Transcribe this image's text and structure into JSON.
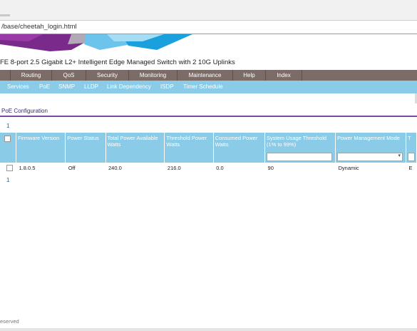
{
  "browser": {
    "address": "/base/cheetah_login.html"
  },
  "header": {
    "title": "FE 8-port 2.5 Gigabit L2+ Intelligent Edge Managed Switch with 2 10G Uplinks"
  },
  "main_menu": {
    "items": [
      {
        "label": "Routing"
      },
      {
        "label": "QoS"
      },
      {
        "label": "Security"
      },
      {
        "label": "Monitoring"
      },
      {
        "label": "Maintenance"
      },
      {
        "label": "Help"
      },
      {
        "label": "Index"
      }
    ]
  },
  "sub_menu": {
    "items": [
      {
        "label": "Services"
      },
      {
        "label": "PoE"
      },
      {
        "label": "SNMP"
      },
      {
        "label": "LLDP"
      },
      {
        "label": "Link Dependency"
      },
      {
        "label": "ISDP"
      },
      {
        "label": "Timer Schedule"
      }
    ],
    "active": "PoE"
  },
  "section": {
    "tab_label": "PoE Configuration"
  },
  "pagination": {
    "top": "1",
    "bottom": "1"
  },
  "table": {
    "headers": [
      "Firmware Version",
      "Power Status",
      "Total Power Available Watts",
      "Threshold Power Watts",
      "Consumed Power Watts",
      "System Usage Threshold (1% to 99%)",
      "Power Management Mode",
      "T"
    ],
    "rows": [
      {
        "firmware": "1.8.0.5",
        "power_status": "Off",
        "total_power": "240.0",
        "threshold_power": "216.0",
        "consumed_power": "0.0",
        "usage_threshold": "90",
        "management_mode": "Dynamic",
        "extra": "E"
      }
    ]
  },
  "footer": {
    "text": "eserved"
  },
  "colors": {
    "menu_bg": "#7c6c68",
    "submenu_bg": "#8acbe8",
    "section_rule": "#7b4aa0",
    "link": "#1b5fa5"
  }
}
